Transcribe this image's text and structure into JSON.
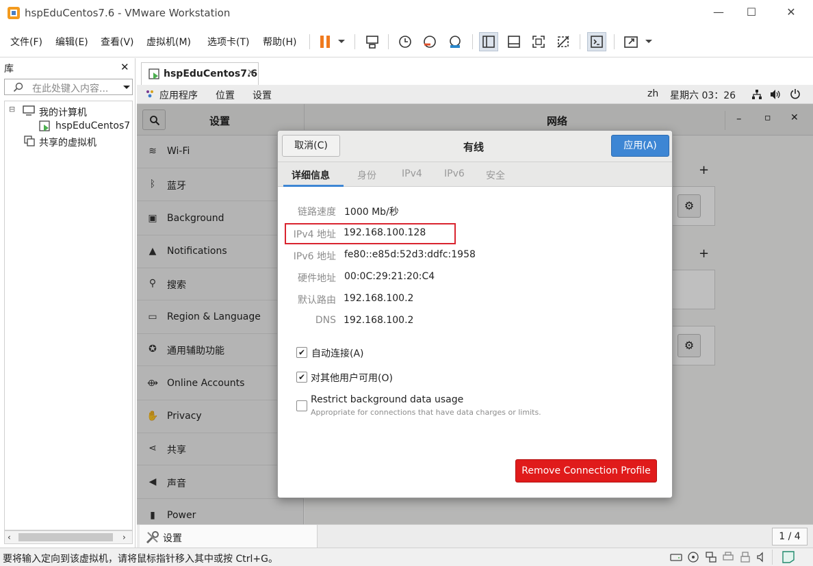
{
  "window": {
    "title": "hspEduCentos7.6 - VMware Workstation",
    "minimize": "—",
    "maximize": "☐",
    "close": "✕"
  },
  "menu": [
    "文件(F)",
    "编辑(E)",
    "查看(V)",
    "虚拟机(M)",
    "选项卡(T)",
    "帮助(H)"
  ],
  "library": {
    "title": "库",
    "close": "✕",
    "search_placeholder": "在此处键入内容...",
    "tree": {
      "root": "我的计算机",
      "vm": "hspEduCentos7",
      "shared": "共享的虚拟机",
      "expander": "⊟"
    }
  },
  "tab": {
    "label": "hspEduCentos7.6",
    "close": "✕"
  },
  "gnome": {
    "apps": "应用程序",
    "places": "位置",
    "settings": "设置",
    "lang": "zh",
    "datetime": "星期六 03：26"
  },
  "settings": {
    "title": "设置",
    "panel_title": "网络",
    "items": [
      {
        "label": "Wi-Fi",
        "icon": "wifi-icon"
      },
      {
        "label": "蓝牙",
        "icon": "bluetooth-icon"
      },
      {
        "label": "Background",
        "icon": "background-icon"
      },
      {
        "label": "Notifications",
        "icon": "bell-icon"
      },
      {
        "label": "搜索",
        "icon": "search-icon"
      },
      {
        "label": "Region & Language",
        "icon": "region-icon"
      },
      {
        "label": "通用辅助功能",
        "icon": "accessibility-icon"
      },
      {
        "label": "Online Accounts",
        "icon": "online-accounts-icon"
      },
      {
        "label": "Privacy",
        "icon": "privacy-icon"
      },
      {
        "label": "共享",
        "icon": "share-icon"
      },
      {
        "label": "声音",
        "icon": "sound-icon"
      },
      {
        "label": "Power",
        "icon": "power-icon"
      }
    ],
    "add": "+",
    "win_min": "–",
    "win_max": "▫",
    "win_close": "✕"
  },
  "dialog": {
    "cancel": "取消(C)",
    "title": "有线",
    "apply": "应用(A)",
    "tabs": [
      "详细信息",
      "身份",
      "IPv4",
      "IPv6",
      "安全"
    ],
    "details": [
      {
        "label": "链路速度",
        "value": "1000 Mb/秒"
      },
      {
        "label": "IPv4 地址",
        "value": "192.168.100.128"
      },
      {
        "label": "IPv6 地址",
        "value": "fe80::e85d:52d3:ddfc:1958"
      },
      {
        "label": "硬件地址",
        "value": "00:0C:29:21:20:C4"
      },
      {
        "label": "默认路由",
        "value": "192.168.100.2"
      },
      {
        "label": "DNS",
        "value": "192.168.100.2"
      }
    ],
    "auto_connect": "自动连接(A)",
    "available_all": "对其他用户可用(O)",
    "restrict": "Restrict background data usage",
    "restrict_hint": "Appropriate for connections that have data charges or limits.",
    "remove": "Remove Connection Profile",
    "colors": {
      "apply": "#3d86d4",
      "remove": "#e01b1b",
      "highlight": "#d9232e"
    }
  },
  "bottom": {
    "label": "设置",
    "page": "1 / 4"
  },
  "status": {
    "text": "要将输入定向到该虚拟机，请将鼠标指针移入其中或按 Ctrl+G。"
  }
}
